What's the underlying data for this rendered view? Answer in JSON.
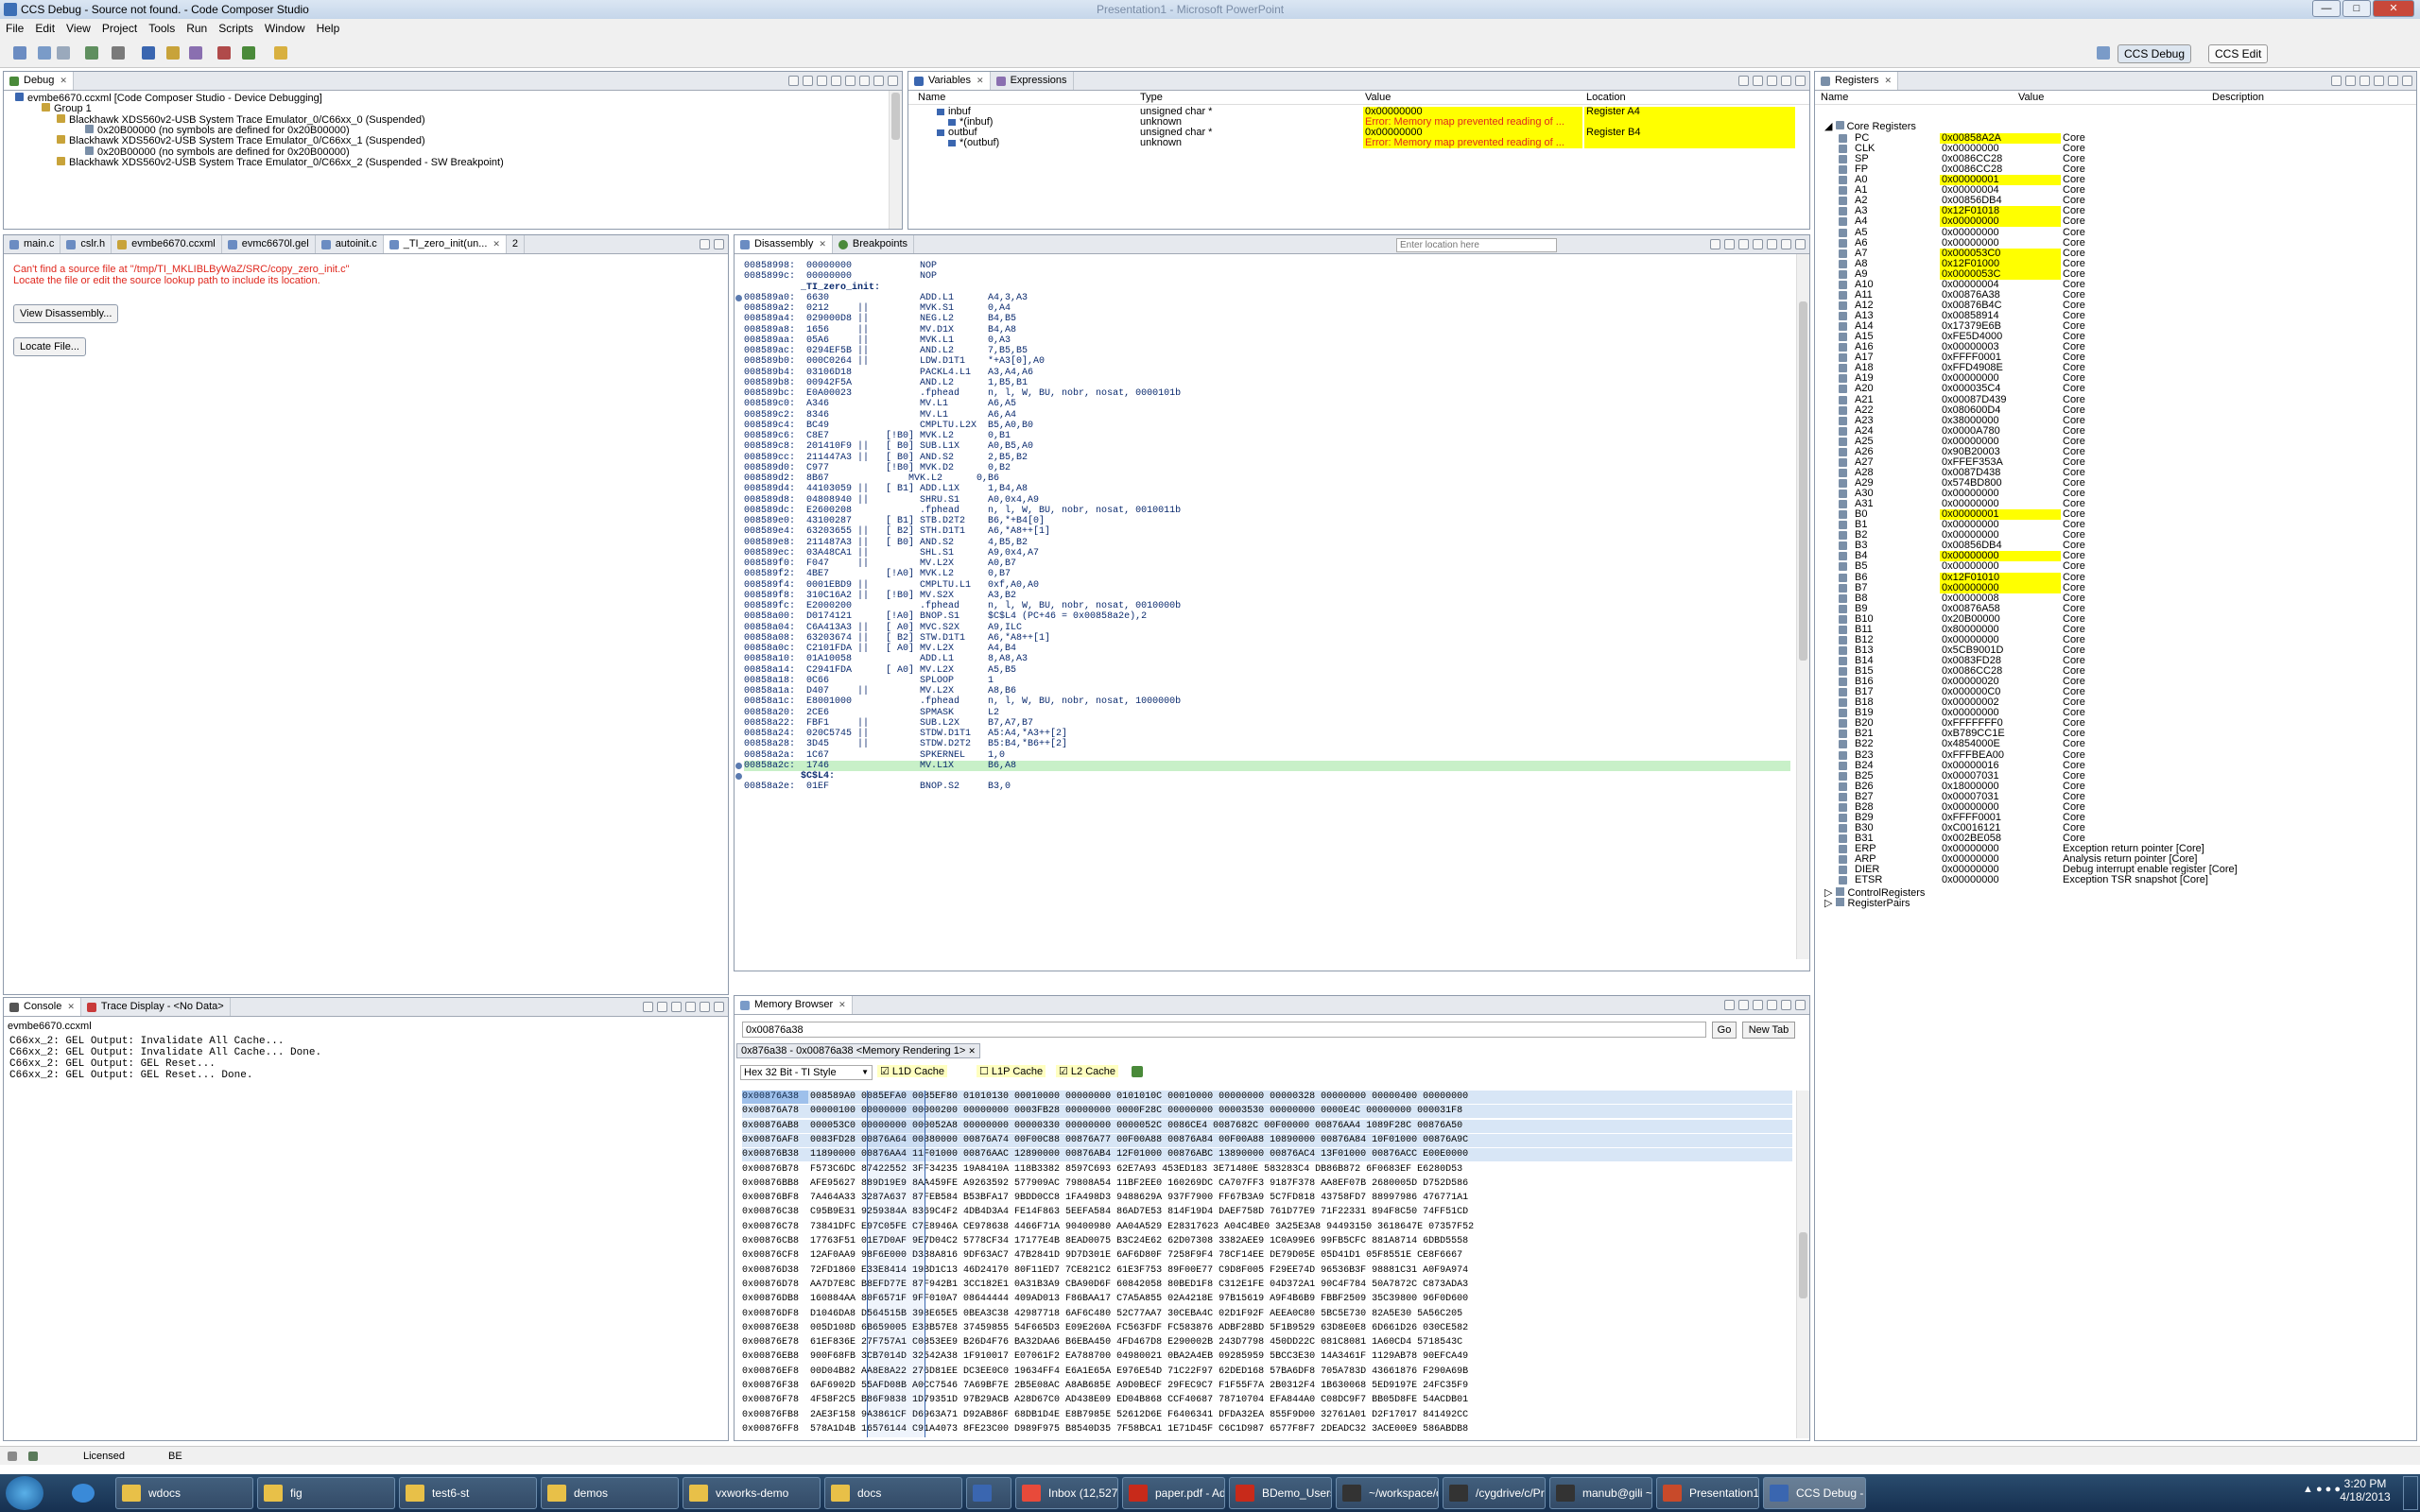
{
  "window": {
    "title": "CCS Debug - Source not found. - Code Composer Studio",
    "right_title": "Presentation1 - Microsoft PowerPoint"
  },
  "menu": [
    "File",
    "Edit",
    "View",
    "Project",
    "Tools",
    "Run",
    "Scripts",
    "Window",
    "Help"
  ],
  "perspectives": {
    "debug": "CCS Debug",
    "edit": "CCS Edit"
  },
  "debug_view": {
    "tab": "Debug",
    "items": [
      "evmbe6670.ccxml [Code Composer Studio - Device Debugging]",
      "Group 1",
      "Blackhawk XDS560v2-USB System Trace Emulator_0/C66xx_0 (Suspended)",
      "0x20B00000  (no symbols are defined for 0x20B00000)",
      "Blackhawk XDS560v2-USB System Trace Emulator_0/C66xx_1 (Suspended)",
      "0x20B00000  (no symbols are defined for 0x20B00000)",
      "Blackhawk XDS560v2-USB System Trace Emulator_0/C66xx_2 (Suspended - SW Breakpoint)"
    ]
  },
  "variables_view": {
    "tabs": [
      "Variables",
      "Expressions"
    ],
    "columns": [
      "Name",
      "Type",
      "Value",
      "Location"
    ],
    "rows": [
      {
        "name": "inbuf",
        "type": "unsigned char *",
        "value": "0x00000000",
        "location": "Register A4"
      },
      {
        "name": "*(inbuf)",
        "type": "unknown",
        "value": "Error: Memory map prevented reading of ...",
        "location": ""
      },
      {
        "name": "outbuf",
        "type": "unsigned char *",
        "value": "0x00000000",
        "location": "Register B4"
      },
      {
        "name": "*(outbuf)",
        "type": "unknown",
        "value": "Error: Memory map prevented reading of ...",
        "location": ""
      }
    ]
  },
  "registers_view": {
    "tab": "Registers",
    "columns": [
      "Name",
      "Value",
      "Description"
    ],
    "group": "Core Registers",
    "rows": [
      [
        "PC",
        "0x00858A2A",
        "Core",
        1
      ],
      [
        "CLK",
        "0x00000000",
        "Core",
        0
      ],
      [
        "SP",
        "0x0086CC28",
        "Core",
        0
      ],
      [
        "FP",
        "0x0086CC28",
        "Core",
        0
      ],
      [
        "A0",
        "0x00000001",
        "Core",
        1
      ],
      [
        "A1",
        "0x00000004",
        "Core",
        0
      ],
      [
        "A2",
        "0x00856DB4",
        "Core",
        0
      ],
      [
        "A3",
        "0x12F01018",
        "Core",
        1
      ],
      [
        "A4",
        "0x00000000",
        "Core",
        1
      ],
      [
        "A5",
        "0x00000000",
        "Core",
        0
      ],
      [
        "A6",
        "0x00000000",
        "Core",
        0
      ],
      [
        "A7",
        "0x000053C0",
        "Core",
        1
      ],
      [
        "A8",
        "0x12F01000",
        "Core",
        1
      ],
      [
        "A9",
        "0x0000053C",
        "Core",
        1
      ],
      [
        "A10",
        "0x00000004",
        "Core",
        0
      ],
      [
        "A11",
        "0x00876A38",
        "Core",
        0
      ],
      [
        "A12",
        "0x00876B4C",
        "Core",
        0
      ],
      [
        "A13",
        "0x00858914",
        "Core",
        0
      ],
      [
        "A14",
        "0x17379E6B",
        "Core",
        0
      ],
      [
        "A15",
        "0xFE5D4000",
        "Core",
        0
      ],
      [
        "A16",
        "0x00000003",
        "Core",
        0
      ],
      [
        "A17",
        "0xFFFF0001",
        "Core",
        0
      ],
      [
        "A18",
        "0xFFD4908E",
        "Core",
        0
      ],
      [
        "A19",
        "0x00000000",
        "Core",
        0
      ],
      [
        "A20",
        "0x000035C4",
        "Core",
        0
      ],
      [
        "A21",
        "0x00087D439",
        "Core",
        0
      ],
      [
        "A22",
        "0x080600D4",
        "Core",
        0
      ],
      [
        "A23",
        "0x38000000",
        "Core",
        0
      ],
      [
        "A24",
        "0x0000A780",
        "Core",
        0
      ],
      [
        "A25",
        "0x00000000",
        "Core",
        0
      ],
      [
        "A26",
        "0x90B20003",
        "Core",
        0
      ],
      [
        "A27",
        "0xFFEF353A",
        "Core",
        0
      ],
      [
        "A28",
        "0x0087D438",
        "Core",
        0
      ],
      [
        "A29",
        "0x574BD800",
        "Core",
        0
      ],
      [
        "A30",
        "0x00000000",
        "Core",
        0
      ],
      [
        "A31",
        "0x00000000",
        "Core",
        0
      ],
      [
        "B0",
        "0x00000001",
        "Core",
        1
      ],
      [
        "B1",
        "0x00000000",
        "Core",
        0
      ],
      [
        "B2",
        "0x00000000",
        "Core",
        0
      ],
      [
        "B3",
        "0x00856DB4",
        "Core",
        0
      ],
      [
        "B4",
        "0x00000000",
        "Core",
        1
      ],
      [
        "B5",
        "0x00000000",
        "Core",
        0
      ],
      [
        "B6",
        "0x12F01010",
        "Core",
        1
      ],
      [
        "B7",
        "0x00000000",
        "Core",
        1
      ],
      [
        "B8",
        "0x00000008",
        "Core",
        0
      ],
      [
        "B9",
        "0x00876A58",
        "Core",
        0
      ],
      [
        "B10",
        "0x20B00000",
        "Core",
        0
      ],
      [
        "B11",
        "0x80000000",
        "Core",
        0
      ],
      [
        "B12",
        "0x00000000",
        "Core",
        0
      ],
      [
        "B13",
        "0x5CB9001D",
        "Core",
        0
      ],
      [
        "B14",
        "0x0083FD28",
        "Core",
        0
      ],
      [
        "B15",
        "0x0086CC28",
        "Core",
        0
      ],
      [
        "B16",
        "0x00000020",
        "Core",
        0
      ],
      [
        "B17",
        "0x000000C0",
        "Core",
        0
      ],
      [
        "B18",
        "0x00000002",
        "Core",
        0
      ],
      [
        "B19",
        "0x00000000",
        "Core",
        0
      ],
      [
        "B20",
        "0xFFFFFFF0",
        "Core",
        0
      ],
      [
        "B21",
        "0xB789CC1E",
        "Core",
        0
      ],
      [
        "B22",
        "0x4854000E",
        "Core",
        0
      ],
      [
        "B23",
        "0xFFFBEA00",
        "Core",
        0
      ],
      [
        "B24",
        "0x00000016",
        "Core",
        0
      ],
      [
        "B25",
        "0x00007031",
        "Core",
        0
      ],
      [
        "B26",
        "0x18000000",
        "Core",
        0
      ],
      [
        "B27",
        "0x00007031",
        "Core",
        0
      ],
      [
        "B28",
        "0x00000000",
        "Core",
        0
      ],
      [
        "B29",
        "0xFFFF0001",
        "Core",
        0
      ],
      [
        "B30",
        "0xC0016121",
        "Core",
        0
      ],
      [
        "B31",
        "0x002BE058",
        "Core",
        0
      ],
      [
        "ERP",
        "0x00000000",
        "Exception return pointer [Core]",
        0
      ],
      [
        "ARP",
        "0x00000000",
        "Analysis return pointer [Core]",
        0
      ],
      [
        "DIER",
        "0x00000000",
        "Debug interrupt enable register [Core]",
        0
      ],
      [
        "ETSR",
        "0x00000000",
        "Exception TSR snapshot [Core]",
        0
      ]
    ],
    "groups": [
      "ControlRegisters",
      "RegisterPairs"
    ]
  },
  "editor": {
    "tabs": [
      "main.c",
      "cslr.h",
      "evmbe6670.ccxml",
      "evmc6670l.gel",
      "autoinit.c",
      "_TI_zero_init(un...",
      "2"
    ],
    "error": "Can't find a source file at \"/tmp/TI_MKLIBLByWaZ/SRC/copy_zero_init.c\"",
    "hint": "Locate the file or edit the source lookup path to include its location.",
    "btn_view": "View Disassembly...",
    "btn_locate": "Locate File..."
  },
  "disassembly": {
    "tabs": [
      "Disassembly",
      "Breakpoints"
    ],
    "location_placeholder": "Enter location here",
    "lines": [
      "00858998:  00000000            NOP",
      "0085899c:  00000000            NOP",
      "          _TI_zero_init:",
      "008589a0:  6630                ADD.L1      A4,3,A3",
      "008589a2:  0212     ||         MVK.S1      0,A4",
      "008589a4:  029000D8 ||         NEG.L2      B4,B5",
      "008589a8:  1656     ||         MV.D1X      B4,A8",
      "008589aa:  05A6     ||         MVK.L1      0,A3",
      "008589ac:  0294EF5B ||         AND.L2      7,B5,B5",
      "008589b0:  000C0264 ||         LDW.D1T1    *+A3[0],A0",
      "008589b4:  03106D18            PACKL4.L1   A3,A4,A6",
      "008589b8:  00942F5A            AND.L2      1,B5,B1",
      "008589bc:  E0A00023            .fphead     n, l, W, BU, nobr, nosat, 0000101b",
      "008589c0:  A346                MV.L1       A6,A5",
      "008589c2:  8346                MV.L1       A6,A4",
      "008589c4:  BC49                CMPLTU.L2X  B5,A0,B0",
      "008589c6:  C8E7          [!B0] MVK.L2      0,B1",
      "008589c8:  201410F9 ||   [ B0] SUB.L1X     A0,B5,A0",
      "008589cc:  211447A3 ||   [ B0] AND.S2      2,B5,B2",
      "008589d0:  C977          [!B0] MVK.D2      0,B2",
      "008589d2:  8B67              MVK.L2      0,B6",
      "008589d4:  44103059 ||   [ B1] ADD.L1X     1,B4,A8",
      "008589d8:  04808940 ||         SHRU.S1     A0,0x4,A9",
      "008589dc:  E2600208            .fphead     n, l, W, BU, nobr, nosat, 0010011b",
      "008589e0:  43100287      [ B1] STB.D2T2    B6,*+B4[0]",
      "008589e4:  63203655 ||   [ B2] STH.D1T1    A6,*A8++[1]",
      "008589e8:  211487A3 ||   [ B0] AND.S2      4,B5,B2",
      "008589ec:  03A48CA1 ||         SHL.S1      A9,0x4,A7",
      "008589f0:  F047     ||         MV.L2X      A0,B7",
      "008589f2:  4BE7          [!A0] MVK.L2      0,B7",
      "008589f4:  0001EBD9 ||         CMPLTU.L1   0xf,A0,A0",
      "008589f8:  310C16A2 ||   [!B0] MV.S2X      A3,B2",
      "008589fc:  E2000200            .fphead     n, l, W, BU, nobr, nosat, 0010000b",
      "00858a00:  D0174121      [!A0] BNOP.S1     $C$L4 (PC+46 = 0x00858a2e),2",
      "00858a04:  C6A413A3 ||   [ A0] MVC.S2X     A9,ILC",
      "00858a08:  63203674 ||   [ B2] STW.D1T1    A6,*A8++[1]",
      "00858a0c:  C2101FDA ||   [ A0] MV.L2X      A4,B4",
      "00858a10:  01A10058            ADD.L1      8,A8,A3",
      "00858a14:  C2941FDA      [ A0] MV.L2X      A5,B5",
      "00858a18:  0C66                SPLOOP      1",
      "00858a1a:  D407     ||         MV.L2X      A8,B6",
      "00858a1c:  E8001000            .fphead     n, l, W, BU, nobr, nosat, 1000000b",
      "00858a20:  2CE6                SPMASK      L2",
      "00858a22:  FBF1     ||         SUB.L2X     B7,A7,B7",
      "00858a24:  020C5745 ||         STDW.D1T1   A5:A4,*A3++[2]",
      "00858a28:  3D45     ||         STDW.D2T2   B5:B4,*B6++[2]",
      "00858a2a:  1C67                SPKERNEL    1,0",
      "00858a2c:  1746                MV.L1X      B6,A8",
      "          $C$L4:",
      "00858a2e:  01EF                BNOP.S2     B3,0"
    ]
  },
  "console": {
    "tabs": [
      "Console",
      "Trace Display - <No Data>"
    ],
    "name": "evmbe6670.ccxml",
    "lines": [
      "C66xx_2: GEL Output: Invalidate All Cache...",
      "C66xx_2: GEL Output: Invalidate All Cache... Done.",
      "C66xx_2: GEL Output: GEL Reset...",
      "C66xx_2: GEL Output: GEL Reset... Done."
    ]
  },
  "memory": {
    "tab": "Memory Browser",
    "address": "0x00876a38",
    "go": "Go",
    "new_tab": "New Tab",
    "rendering_tab": "0x876a38 - 0x00876a38 <Memory Rendering 1>",
    "style": "Hex 32 Bit - TI Style",
    "l1d": "L1D Cache",
    "l1p": "L1P Cache",
    "l2": "L2 Cache",
    "rows": [
      "0x00876A38  008589A0 0085EFA0 0085EF80 01010130 00010000 00000000 0101010C 00010000 00000000 00000328 00000000 00000400 00000000",
      "0x00876A78  00000100 00000000 00000200 00000000 0003FB28 00000000 0000F28C 00000000 00003530 00000000 0000E4C 00000000 000031F8",
      "0x00876AB8  000053C0 00000000 000052A8 00000000 00000330 00000000 0000052C 0086CE4 0087682C 00F00000 00876AA4 1089F28C 00876A50",
      "0x00876AF8  0083FD28 00876A64 00880000 00876A74 00F00C88 00876A77 00F00A88 00876A84 00F00A88 10890000 00876A84 10F01000 00876A9C",
      "0x00876B38  11890000 00876AA4 11F01000 00876AAC 12890000 00876AB4 12F01000 00876ABC 13890000 00876AC4 13F01000 00876ACC E00E0000",
      "0x00876B78  F573C6DC 87422552 3FF34235 19A8410A 118B3382 8597C693 62E7A93 453ED183 3E71480E 583283C4 DB86B872 6F0683EF E6280D53",
      "0x00876BB8  AFE95627 889D19E9 8AA459FE A9263592 577909AC 79808A54 11BF2EE0 160269DC CA707FF3 9187F378 AA8EF07B 2680005D D752D586",
      "0x00876BF8  7A464A33 3287A637 87FEB584 B53BFA17 9BDD0CC8 1FA498D3 9488629A 937F7900 FF67B3A9 5C7FD818 43758FD7 88997986 476771A1",
      "0x00876C38  C95B9E31 9259384A 8369C4F2 4DB4D3A4 FE14F863 5EEFA584 86AD7E53 814F19D4 DAEF758D 761D77E9 71F22331 894F8C50 74FF51CD",
      "0x00876C78  73841DFC E97C05FE C7E8946A CE978638 4466F71A 90400980 AA04A529 E28317623 A04C4BE0 3A25E3A8 94493150 3618647E 07357F52",
      "0x00876CB8  17763F51 01E7D0AF 9E7D04C2 5778CF34 17177E4B 8EAD0075 B3C24E62 62D07308 3382AEE9 1C0A99E6 99FB5CFC 881A8714 6DBD5558",
      "0x00876CF8  12AF0AA9 98F6E000 D338A816 9DF63AC7 47B2841D 9D7D301E 6AF6D80F 7258F9F4 78CF14EE DE79D05E 05D41D1 05F8551E CE8F6667",
      "0x00876D38  72FD1860 E33E8414 19BD1C13 46D24170 80F11ED7 7CE821C2 61E3F753 89F00E77 C9D8F005 F29EE74D 96536B3F 98881C31 A0F9A974",
      "0x00876D78  AA7D7E8C B8EFD77E 87F942B1 3CC182E1 0A31B3A9 CBA90D6F 60842058 80BED1F8 C312E1FE 04D372A1 90C4F784 50A7872C C873ADA3",
      "0x00876DB8  160884AA 80F6571F 9FF010A7 08644444 409AD013 F86BAA17 C7A5A855 02A4218E 97B15619 A9F4B6B9 FBBF2509 35C39800 96F0D600",
      "0x00876DF8  D1046DA8 D564515B 398E65E5 0BEA3C38 42987718 6AF6C480 52C77AA7 30CEBA4C 02D1F92F AEEA0C80 5BC5E730 82A5E30 5A56C205",
      "0x00876E38  005D108D 6B659005 E38B57E8 37459855 54F665D3 E09E260A FC563FDF FC583876 ADBF28BD 5F1B9529 63D8E0E8 6D661D26 030CE582",
      "0x00876E78  61EF836E 27F757A1 C0853EE9 B26D4F76 BA32DAA6 B6EBA450 4FD467D8 E290002B 243D7798 450DD22C 081C8081 1A60CD4 5718543C",
      "0x00876EB8  900F68FB 3CB7014D 32542A38 1F910017 E07061F2 EA788700 04980021 0BA2A4EB 09285959 5BCC3E30 14A3461F 1129AB78 90EFCA49",
      "0x00876EF8  00D04B82 AA8E8A22 276D81EE DC3EE0C0 19634FF4 E6A1E65A E976E54D 71C22F97 62DED168 57BA6DF8 705A783D 43661876 F290A69B",
      "0x00876F38  6AF6902D 55AFD08B A0CC7546 7A69BF7E 2B5E08AC A8AB685E A9D0BECF 29FEC9C7 F1F55F7A 2B0312F4 1B630068 5ED9197E 24FC35F9",
      "0x00876F78  4F58F2C5 B86F9838 1D79351D 97B29ACB A28D67C0 AD438E09 ED04B868 CCF40687 78710704 EFA844A0 C08DC9F7 BB05D8FE 54ACDB01",
      "0x00876FB8  2AE3F158 9A3861CF D6963A71 D92AB86F 68DB1D4E E8B7985E 52612D6E F6406341 DFDA32EA 855F9D00 32761A01 D2F17017 841492CC",
      "0x00876FF8  578A1D4B 16576144 C91A4073 8FE23C00 D989F975 B8540D35 7F58BCA1 1E71D45F C6C1D987 6577F8F7 2DEADC32 3ACE00E9 586ABDB8"
    ]
  },
  "statusbar": {
    "license": "Licensed",
    "endian": "BE"
  },
  "taskbar": {
    "items": [
      "wdocs",
      "fig",
      "test6-st",
      "demos",
      "vxworks-demo",
      "docs",
      "",
      "Inbox (12,527) -...",
      "paper.pdf - Ado...",
      "BDemo_Users_M...",
      "~/workspace/or...",
      "/cygdrive/c/Pro...",
      "manub@gili ~",
      "Presentation1 - ...",
      "CCS Debug - So..."
    ],
    "time": "3:20 PM",
    "date": "4/18/2013"
  }
}
